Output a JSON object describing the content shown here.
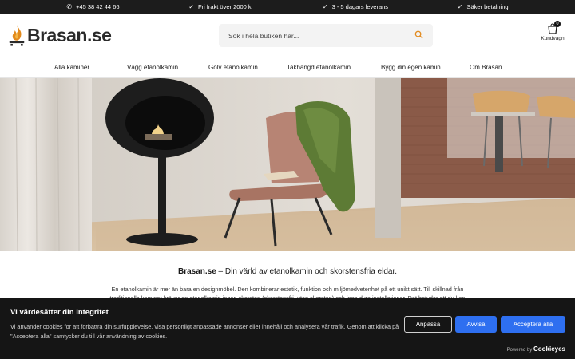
{
  "topbar": {
    "phone": "+45 38 42 44 66",
    "shipping": "Fri frakt över 2000 kr",
    "delivery": "3 - 5 dagars leverans",
    "payment": "Säker betalning"
  },
  "header": {
    "logo_text": "Brasan.se",
    "search_placeholder": "Sök i hela butiken här...",
    "cart_label": "Kundvagn",
    "cart_count": "0"
  },
  "nav": {
    "items": [
      "Alla kaminer",
      "Vägg etanolkamin",
      "Golv etanolkamin",
      "Takhängd etanolkamin",
      "Bygg din egen kamin",
      "Om Brasan"
    ]
  },
  "content": {
    "headline_brand": "Brasan.se",
    "headline_rest": " – Din värld av etanolkamin och skorstensfria eldar.",
    "paragraph": "En etanolkamin är mer än bara en designmöbel. Den kombinerar estetik, funktion och miljömedvetenhet på ett unikt sätt. Till skillnad från traditionella kaminer kräver en etanolkamin ingen skorsten (skorstensfri, utan skorsten) och inga dyra installationer. Det betyder att du kan"
  },
  "cookie": {
    "title": "Vi värdesätter din integritet",
    "text": "Vi använder cookies för att förbättra din surfupplevelse, visa personligt anpassade annonser eller innehåll och analysera vår trafik. Genom att klicka på \"Acceptera alla\" samtycker du till vår användning av cookies.",
    "adjust_label": "Anpassa",
    "reject_label": "Avvisa",
    "accept_label": "Acceptera alla",
    "powered_prefix": "Powered by",
    "powered_brand": "Cookieyes"
  },
  "colors": {
    "accent": "#e28a1d",
    "button_blue": "#2e6ff0",
    "topbar": "#1c1c1c",
    "cookie_bg": "#151515"
  }
}
